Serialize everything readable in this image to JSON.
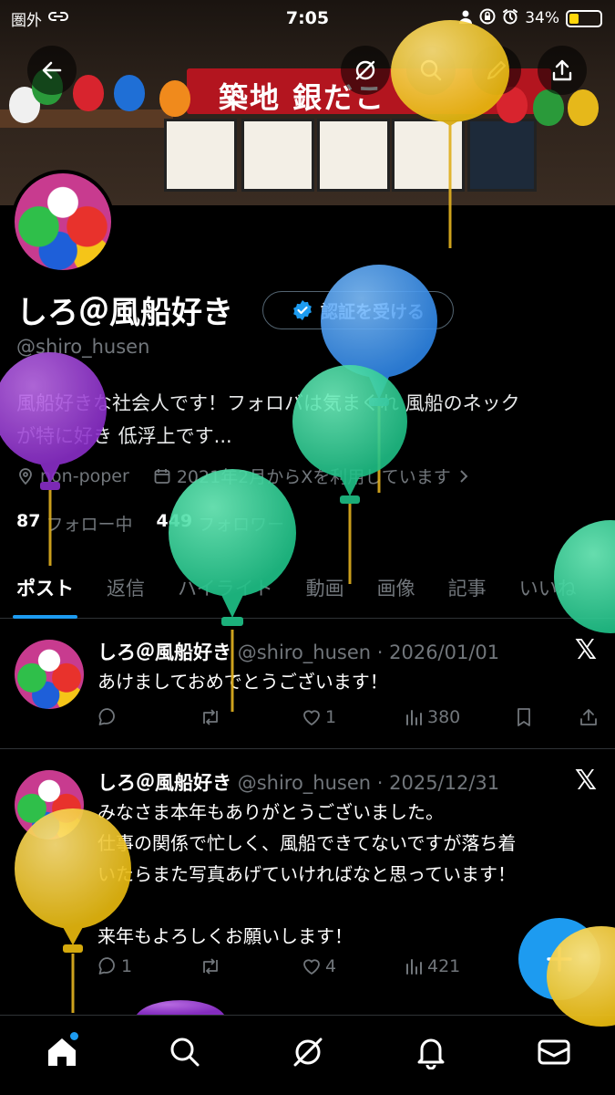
{
  "status_bar": {
    "carrier": "圏外",
    "time": "7:05",
    "battery": "34%"
  },
  "banner": {
    "sign_text": "築地 銀だこ"
  },
  "profile": {
    "name": "しろ＠風船好き",
    "verify_button": "認証を受ける",
    "handle": "@shiro_husen",
    "bio_line1": "風船好きな社会人です！フォロバは気まぐれ 風船のネック",
    "bio_line2": "が特に好き 低浮上です...",
    "location": "non-poper",
    "joined": "2021年2月からXを利用しています",
    "following_count": "87",
    "following_label": "フォロー中",
    "followers_count": "449",
    "followers_label": "フォロワー"
  },
  "tabs": [
    "ポスト",
    "返信",
    "ハイライト",
    "動画",
    "画像",
    "記事",
    "いいね"
  ],
  "posts": [
    {
      "name": "しろ＠風船好き",
      "handle_date": "@shiro_husen · 2026/01/01",
      "text": "あけましておめでとうございます！",
      "replies": "",
      "likes": "1",
      "views": "380"
    },
    {
      "name": "しろ＠風船好き",
      "handle_date": "@shiro_husen · 2025/12/31",
      "text_lines": [
        "みなさま本年もありがとうございました。",
        "仕事の関係で忙しく、風船できてないですが落ち着",
        "いたらまた写真あげていければなと思っています！",
        "",
        "来年もよろしくお願いします！"
      ],
      "replies": "1",
      "likes": "4",
      "views": "421"
    }
  ],
  "colors": {
    "accent": "#1d9bf0",
    "background": "#000000",
    "muted": "#71767b"
  }
}
